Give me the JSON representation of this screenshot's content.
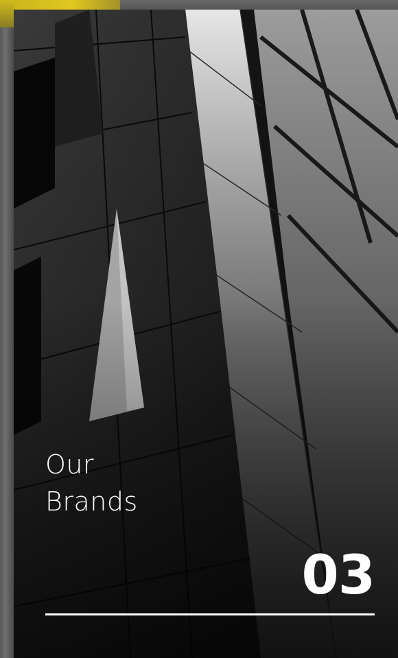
{
  "card": {
    "title_line1": "Our",
    "title_line2": "Brands",
    "number": "03",
    "background_image": "building-facade-photo"
  },
  "colors": {
    "accent": "#e0c820",
    "text": "#ffffff"
  }
}
